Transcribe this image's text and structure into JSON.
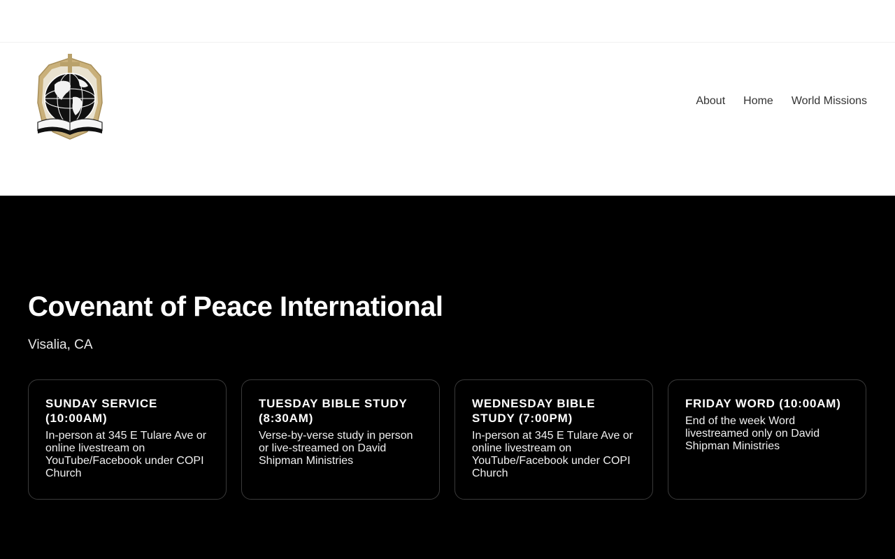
{
  "header": {
    "logo_alt": "COPI globe and cross logo",
    "nav": [
      {
        "label": "About"
      },
      {
        "label": "Home"
      },
      {
        "label": "World Missions"
      }
    ]
  },
  "hero": {
    "title": "Covenant of Peace International",
    "location": "Visalia, CA"
  },
  "services": [
    {
      "title": "SUNDAY SERVICE (10:00AM)",
      "description": "In-person at 345 E Tulare Ave or online livestream on YouTube/Facebook under COPI Church"
    },
    {
      "title": "TUESDAY BIBLE STUDY (8:30AM)",
      "description": "Verse-by-verse study in person or live-streamed on David Shipman Ministries"
    },
    {
      "title": "WEDNESDAY BIBLE STUDY (7:00PM)",
      "description": "In-person at 345 E Tulare Ave or online livestream on YouTube/Facebook under COPI Church"
    },
    {
      "title": "FRIDAY WORD (10:00AM)",
      "description": "End of the week Word livestreamed only on David Shipman Ministries"
    }
  ],
  "colors": {
    "hero_bg": "#000000",
    "logo_gold": "#c9b07a"
  }
}
